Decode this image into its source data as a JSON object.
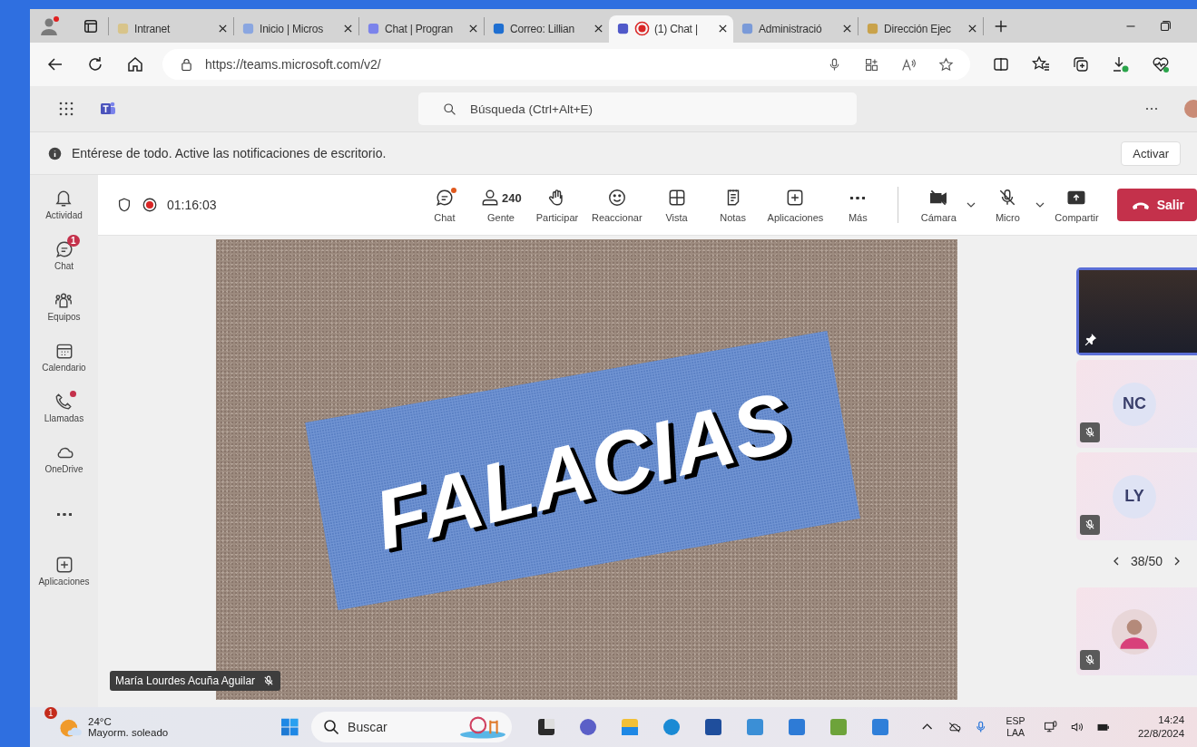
{
  "browser": {
    "tabs": [
      {
        "title": "Intranet",
        "selected": false,
        "recording": false
      },
      {
        "title": "Inicio | Micros",
        "selected": false,
        "recording": false
      },
      {
        "title": "Chat | Progran",
        "selected": false,
        "recording": false
      },
      {
        "title": "Correo: Lillian",
        "selected": false,
        "recording": false
      },
      {
        "title": "(1) Chat |",
        "selected": true,
        "recording": true
      },
      {
        "title": "Administració",
        "selected": false,
        "recording": false
      },
      {
        "title": "Dirección Ejec",
        "selected": false,
        "recording": false
      }
    ],
    "url": "https://teams.microsoft.com/v2/"
  },
  "teams": {
    "search": {
      "placeholder": "Búsqueda (Ctrl+Alt+E)"
    },
    "banner": {
      "text": "Entérese de todo. Active las notificaciones de escritorio.",
      "button": "Activar"
    },
    "rail": [
      {
        "label": "Actividad",
        "dot": false
      },
      {
        "label": "Chat",
        "badge": "1",
        "dot": false
      },
      {
        "label": "Equipos",
        "dot": false
      },
      {
        "label": "Calendario",
        "dot": false
      },
      {
        "label": "Llamadas",
        "dot": true
      },
      {
        "label": "OneDrive",
        "dot": false
      },
      {
        "dot": false
      },
      {
        "label": "Aplicaciones",
        "dot": false
      }
    ],
    "meeting": {
      "timer": "01:16:03",
      "recording": true,
      "toolbar": [
        {
          "label": "Chat",
          "dot": true,
          "dropdown": false
        },
        {
          "label": "Gente",
          "count": "240",
          "dot": false,
          "dropdown": false
        },
        {
          "label": "Participar",
          "dot": false,
          "dropdown": false
        },
        {
          "label": "Reaccionar",
          "dot": false,
          "dropdown": false
        },
        {
          "label": "Vista",
          "dot": false,
          "dropdown": false
        },
        {
          "label": "Notas",
          "dot": false,
          "dropdown": false
        },
        {
          "label": "Aplicaciones",
          "dot": false,
          "dropdown": false
        },
        {
          "label": "Más",
          "dot": false,
          "dropdown": false
        },
        {
          "label": "Cámara",
          "dot": false,
          "dropdown": true
        },
        {
          "label": "Micro",
          "dot": false,
          "dropdown": true
        },
        {
          "label": "Compartir",
          "dot": false,
          "dropdown": false
        }
      ],
      "leave": "Salir"
    },
    "slide": {
      "title": "FALACIAS"
    },
    "presenter": {
      "name": "María Lourdes Acuña Aguilar",
      "muted": true
    },
    "gallery": {
      "tiles": [
        {
          "kind": "video",
          "muted": false,
          "pinned": true
        },
        {
          "kind": "initials",
          "initials": "NC",
          "muted": true,
          "pinned": false
        },
        {
          "kind": "initials",
          "initials": "LY",
          "muted": true,
          "pinned": false
        }
      ],
      "pager": "38/50",
      "own_tile": {
        "kind": "avatar",
        "muted": true,
        "pinned": false
      }
    }
  },
  "taskbar": {
    "weather": {
      "badge": "1",
      "temperature": "24°C",
      "condition": "Mayorm. soleado"
    },
    "search": {
      "placeholder": "Buscar"
    },
    "language": {
      "top": "ESP",
      "bottom": "LAA"
    },
    "time": "14:24",
    "date": "22/8/2024"
  }
}
